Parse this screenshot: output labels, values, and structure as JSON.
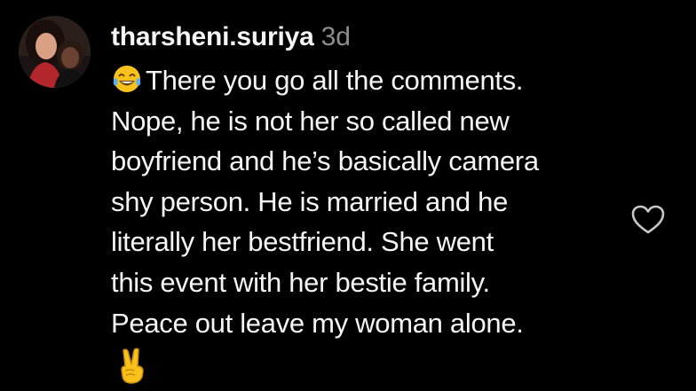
{
  "comment": {
    "username": "tharsheni.suriya",
    "timestamp": "3d",
    "lines": [
      "There you go all the comments.",
      "Nope, he is not her so called new",
      "boyfriend and he’s basically camera",
      "shy person. He is married and he",
      "literally her bestfriend. She went",
      "this event with her bestie family.",
      "Peace out leave my woman alone."
    ],
    "leading_emoji": "tears-of-joy-emoji",
    "trailing_emoji": "victory-hand-emoji"
  },
  "actions": {
    "like_icon": "heart-outline-icon"
  },
  "colors": {
    "background": "#000000",
    "text": "#f5f5f5",
    "muted": "#8e8e8e",
    "emoji_yellow": "#f7c21b"
  }
}
